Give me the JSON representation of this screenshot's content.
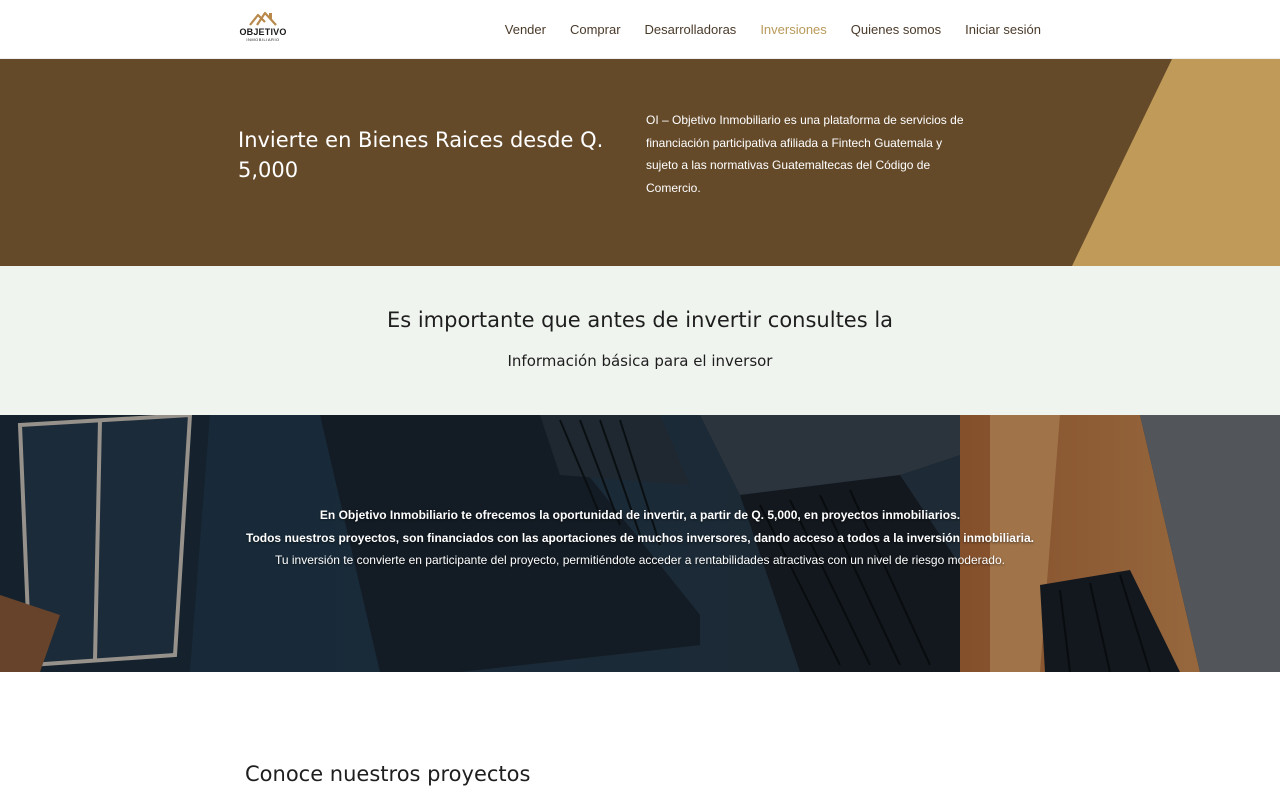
{
  "header": {
    "logo": {
      "name": "OBJETIVO",
      "sub": "INMOBILIARIO",
      "icon": "house-roof-logo-icon"
    },
    "nav": [
      {
        "label": "Vender",
        "active": false
      },
      {
        "label": "Comprar",
        "active": false
      },
      {
        "label": "Desarrolladoras",
        "active": false
      },
      {
        "label": "Inversiones",
        "active": true
      },
      {
        "label": "Quienes somos",
        "active": false
      },
      {
        "label": "Iniciar sesión",
        "active": false
      }
    ]
  },
  "hero": {
    "title": "Invierte en Bienes Raices desde Q. 5,000",
    "description": "OI – Objetivo Inmobiliario es una plataforma de servicios de financiación participativa afiliada a Fintech Guatemala y sujeto a las normativas Guatemaltecas del Código de Comercio.",
    "colors": {
      "background": "#654a2a",
      "accent": "#c09a58"
    }
  },
  "info": {
    "title": "Es importante que antes de invertir consultes la",
    "link": "Información básica para el inversor"
  },
  "photo": {
    "lines": [
      "En Objetivo Inmobiliario te ofrecemos la oportunidad de invertir, a partir de Q. 5,000, en proyectos inmobiliarios.",
      "Todos nuestros proyectos, son financiados con las aportaciones de muchos inversores, dando acceso a todos a la inversión inmobiliaria.",
      "Tu inversión te convierte en participante del proyecto, permitiéndote acceder a rentabilidades atractivas con un nivel de riesgo moderado."
    ]
  },
  "projects": {
    "title": "Conoce nuestros proyectos"
  }
}
